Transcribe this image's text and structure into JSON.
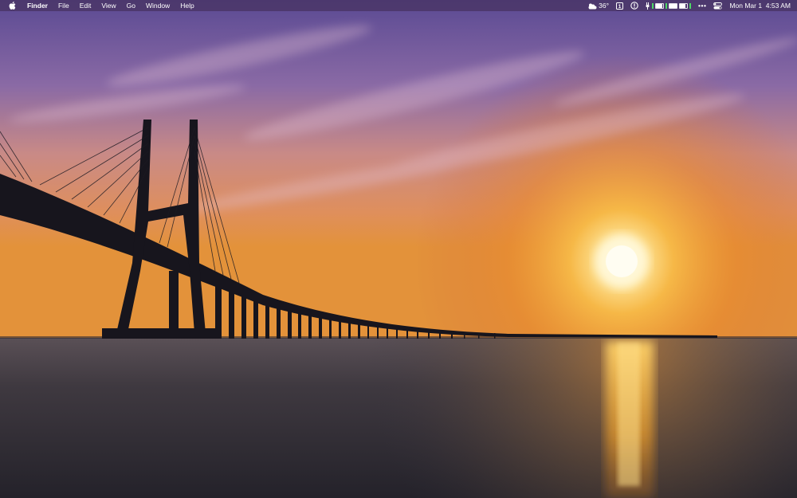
{
  "menubar": {
    "apple_icon": "apple-logo-icon",
    "app_name": "Finder",
    "menus": [
      "File",
      "Edit",
      "View",
      "Go",
      "Window",
      "Help"
    ],
    "weather": {
      "icon": "weather-partly-cloudy-icon",
      "temp": "36°"
    },
    "calendar_day": "1",
    "status_icons": [
      "calendar-icon",
      "info-icon",
      "battery-status-icon",
      "more-icon",
      "control-center-icon"
    ],
    "more_glyph": "•••",
    "clock": "Mon Mar 1  4:53 AM"
  },
  "battery": {
    "levels": [
      0.9,
      1.0,
      0.75
    ],
    "accent": "#4cd964"
  },
  "wallpaper": {
    "description_icon": "bridge-sunset-wallpaper",
    "colors": {
      "sky_top": "#6a4f9a",
      "sky_mid": "#c9857a",
      "sun": "#fff4c8",
      "horizon": "#e8962c",
      "water": "#3a3640"
    }
  }
}
